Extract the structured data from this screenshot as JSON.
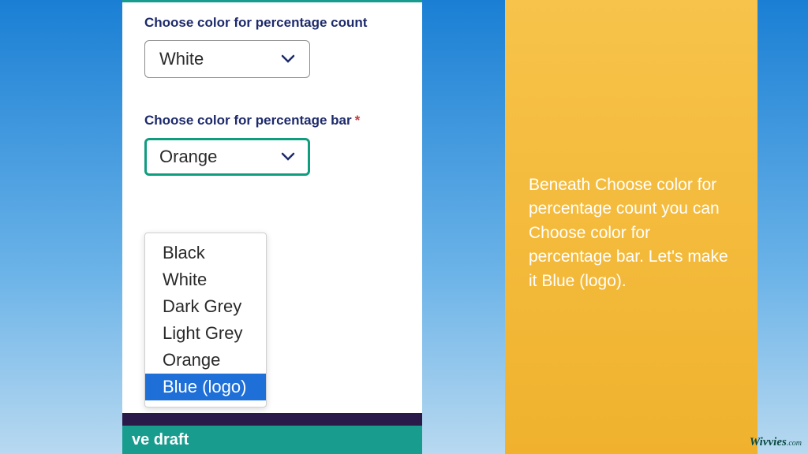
{
  "form": {
    "field1": {
      "label": "Choose color for percentage count",
      "selected": "White"
    },
    "field2": {
      "label": "Choose color for percentage bar",
      "required_mark": "*",
      "selected": "Orange",
      "options": [
        "Black",
        "White",
        "Dark Grey",
        "Light Grey",
        "Orange",
        "Blue (logo)"
      ],
      "highlighted": "Blue (logo)"
    },
    "footer_button": "ve draft"
  },
  "instruction": "Beneath Choose color for percentage count you can Choose color for percentage bar. Let's make it Blue (logo).",
  "brand": {
    "name": "Wivvies",
    "tld": ".com"
  },
  "colors": {
    "teal": "#179c8e",
    "navy": "#1d2a6b",
    "gold": "#f0b22e",
    "blue_accent": "#1e6fd8"
  }
}
